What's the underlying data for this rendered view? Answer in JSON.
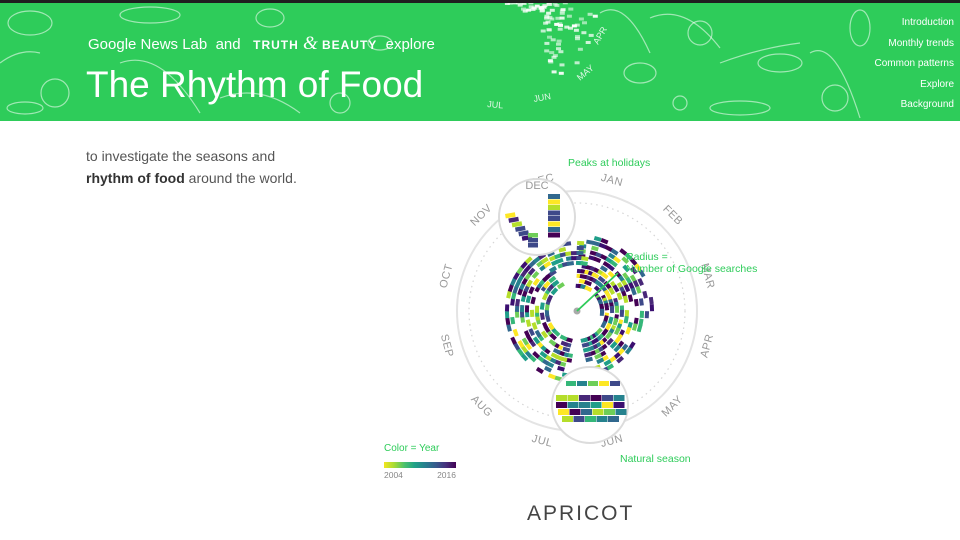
{
  "header": {
    "brand": "Google News Lab",
    "and1": "and",
    "partner": "TRUTH",
    "amp": "&",
    "partner2": "BEAUTY",
    "verb": "explore",
    "title": "The Rhythm of Food",
    "bg_color": "#2ecc5a",
    "art_months": [
      "APR",
      "MAY",
      "JUN",
      "JUL"
    ]
  },
  "nav": {
    "items": [
      "Introduction",
      "Monthly trends",
      "Common patterns",
      "Explore",
      "Background"
    ]
  },
  "intro": {
    "line1": "to investigate the seasons and",
    "bold": "rhythm of food",
    "line2_rest": " around the world."
  },
  "viz": {
    "months": [
      "JAN",
      "FEB",
      "MAR",
      "APR",
      "MAY",
      "JUN",
      "JUL",
      "AUG",
      "SEP",
      "OCT",
      "NOV",
      "DEC"
    ],
    "annotations": {
      "holidays": "Peaks at holidays",
      "radius1": "Radius =",
      "radius2": "Number of Google searches",
      "season": "Natural season"
    },
    "legend": {
      "label": "Color = Year",
      "start": "2004",
      "end": "2016"
    },
    "food": "APRICOT",
    "accent": "#2ecc5a"
  }
}
